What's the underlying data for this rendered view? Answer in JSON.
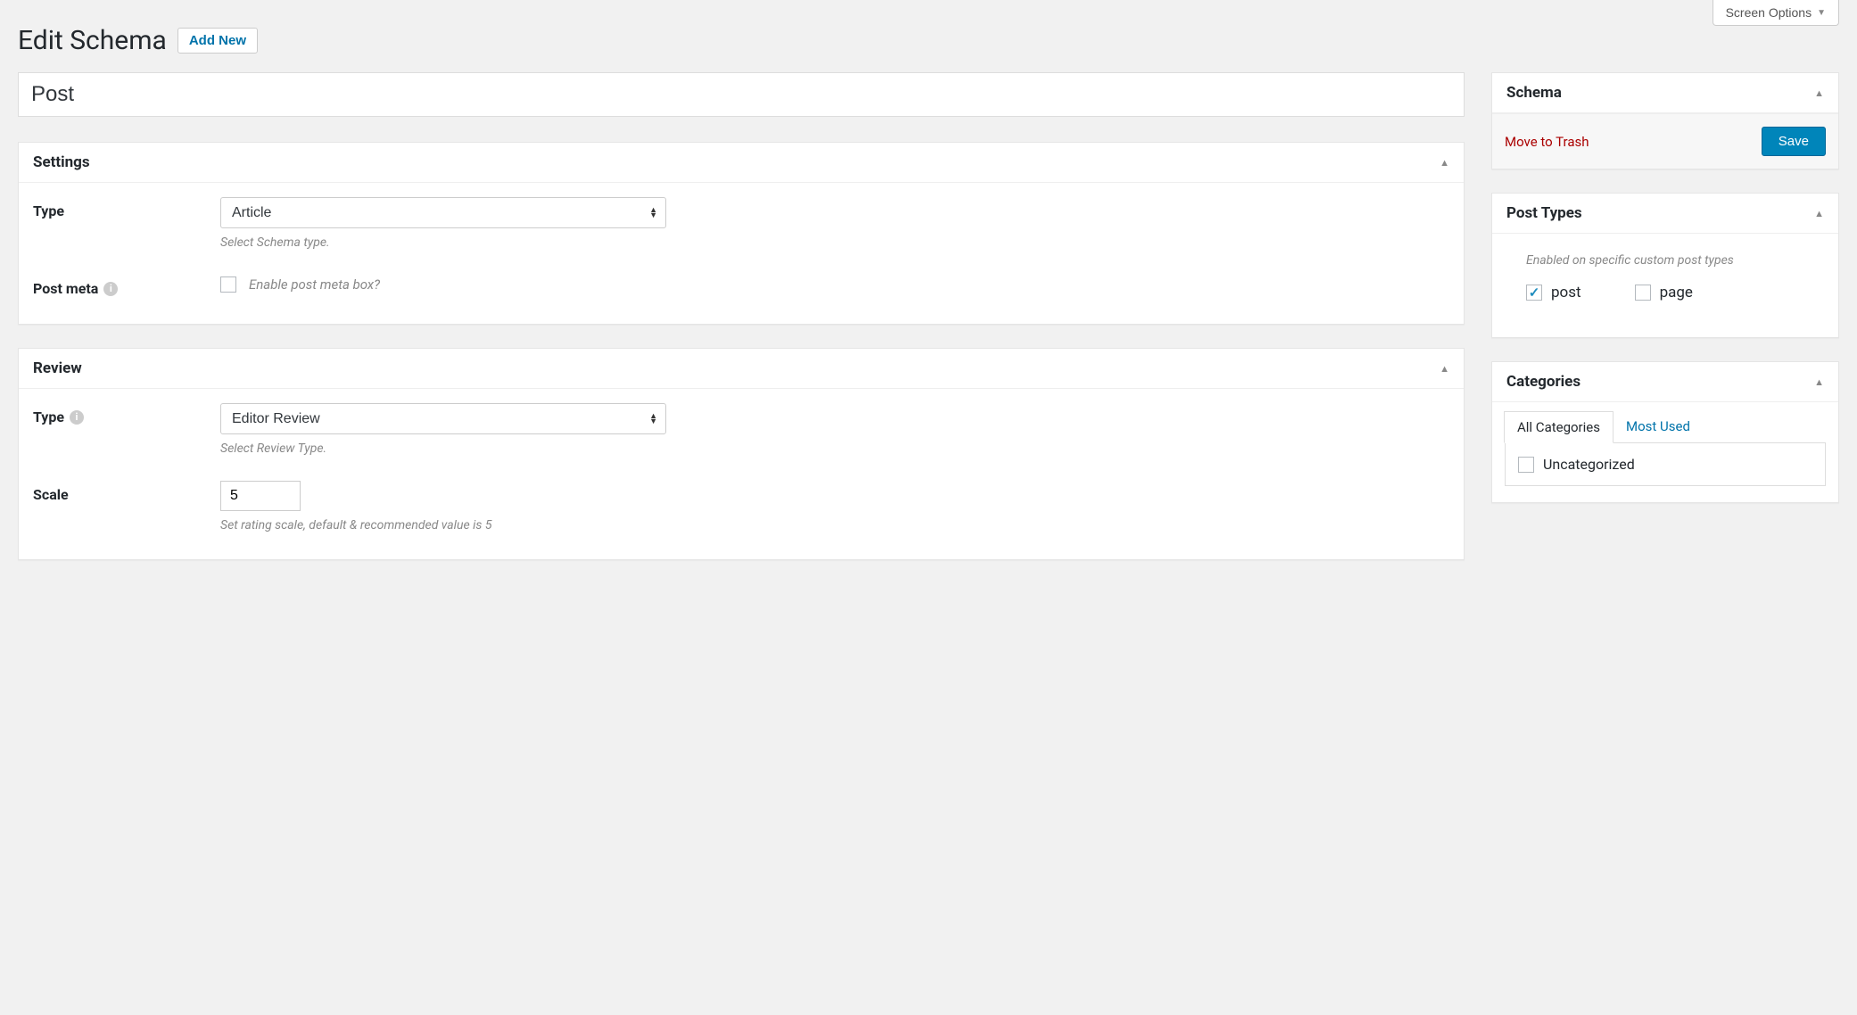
{
  "screen_options_label": "Screen Options",
  "page_title": "Edit Schema",
  "add_new_label": "Add New",
  "title_value": "Post",
  "settings": {
    "heading": "Settings",
    "type_label": "Type",
    "type_value": "Article",
    "type_help": "Select Schema type.",
    "post_meta_label": "Post meta",
    "post_meta_checkbox_label": "Enable post meta box?"
  },
  "review": {
    "heading": "Review",
    "type_label": "Type",
    "type_value": "Editor Review",
    "type_help": "Select Review Type.",
    "scale_label": "Scale",
    "scale_value": "5",
    "scale_help": "Set rating scale, default & recommended value is 5"
  },
  "schema_box": {
    "heading": "Schema",
    "trash_label": "Move to Trash",
    "save_label": "Save"
  },
  "post_types": {
    "heading": "Post Types",
    "description": "Enabled on specific custom post types",
    "options": [
      {
        "label": "post",
        "checked": true
      },
      {
        "label": "page",
        "checked": false
      }
    ]
  },
  "categories": {
    "heading": "Categories",
    "tab_all": "All Categories",
    "tab_most": "Most Used",
    "items": [
      {
        "label": "Uncategorized",
        "checked": false
      }
    ]
  }
}
